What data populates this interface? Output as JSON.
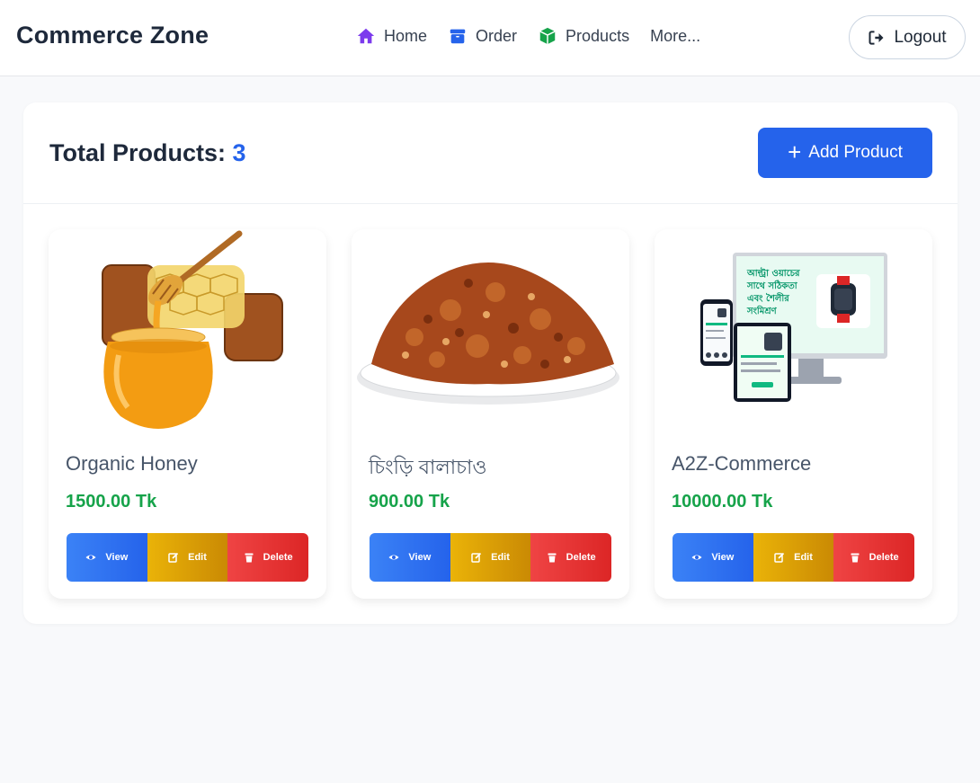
{
  "brand": "Commerce Zone",
  "nav": [
    {
      "label": "Home",
      "icon": "home-icon",
      "color": "#7c3aed"
    },
    {
      "label": "Order",
      "icon": "box-icon",
      "color": "#2563eb"
    },
    {
      "label": "Products",
      "icon": "cube-icon",
      "color": "#16a34a"
    },
    {
      "label": "More..."
    }
  ],
  "logout_label": "Logout",
  "summary": {
    "label": "Total Products:",
    "count": "3"
  },
  "add_button_label": "Add Product",
  "products": [
    {
      "name": "Organic Honey",
      "price": "1500.00 Tk",
      "image": "honey-jar-image"
    },
    {
      "name": "চিংড়ি বালাচাও",
      "price": "900.00 Tk",
      "image": "shrimp-balachao-plate-image"
    },
    {
      "name": "A2Z-Commerce",
      "price": "10000.00 Tk",
      "image": "website-devices-mockup-image"
    }
  ],
  "actions": {
    "view": "View",
    "edit": "Edit",
    "delete": "Delete"
  },
  "mockup": {
    "headline": [
      "আল্ট্রা ওয়াচের",
      "সাথে সঠিকতা",
      "এবং শৈলীর",
      "সংমিশ্রণ"
    ]
  },
  "colors": {
    "accent": "#2563eb",
    "price": "#16a34a",
    "view": "#2563eb",
    "edit": "#ca8a04",
    "delete": "#dc2626"
  }
}
